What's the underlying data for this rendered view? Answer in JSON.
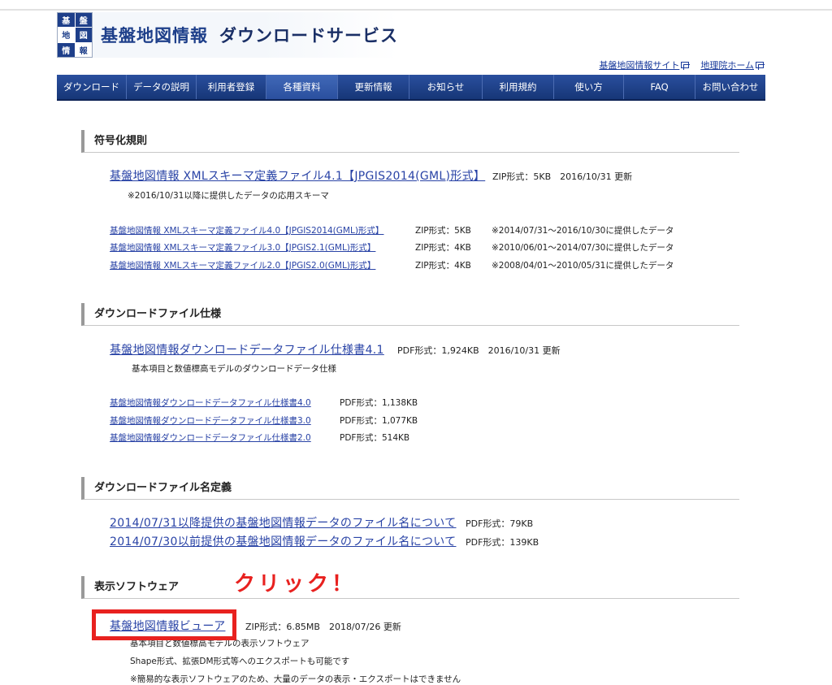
{
  "header": {
    "logo_cells": [
      "基",
      "盤",
      "地",
      "図",
      "情",
      "報"
    ],
    "title": "基盤地図情報",
    "subtitle": "ダウンロードサービス",
    "links": [
      {
        "label": "基盤地図情報サイト"
      },
      {
        "label": "地理院ホーム"
      }
    ]
  },
  "nav": {
    "items": [
      {
        "label": "ダウンロード"
      },
      {
        "label": "データの説明"
      },
      {
        "label": "利用者登録"
      },
      {
        "label": "各種資料",
        "active": true
      },
      {
        "label": "更新情報"
      },
      {
        "label": "お知らせ"
      },
      {
        "label": "利用規約"
      },
      {
        "label": "使い方"
      },
      {
        "label": "FAQ"
      },
      {
        "label": "お問い合わせ"
      }
    ]
  },
  "sections": {
    "encoding": {
      "heading": "符号化規則",
      "main": {
        "link": "基盤地図情報 XMLスキーマ定義ファイル4.1【JPGIS2014(GML)形式】",
        "meta": "ZIP形式：5KB　2016/10/31 更新",
        "note": "※2016/10/31以降に提供したデータの応用スキーマ"
      },
      "rows": [
        {
          "link": "基盤地図情報 XMLスキーマ定義ファイル4.0【JPGIS2014(GML)形式】",
          "format": "ZIP形式：5KB",
          "note": "※2014/07/31～2016/10/30に提供したデータ"
        },
        {
          "link": "基盤地図情報 XMLスキーマ定義ファイル3.0【JPGIS2.1(GML)形式】",
          "format": "ZIP形式：4KB",
          "note": "※2010/06/01～2014/07/30に提供したデータ"
        },
        {
          "link": "基盤地図情報 XMLスキーマ定義ファイル2.0【JPGIS2.0(GML)形式】",
          "format": "ZIP形式：4KB",
          "note": "※2008/04/01～2010/05/31に提供したデータ"
        }
      ]
    },
    "spec": {
      "heading": "ダウンロードファイル仕様",
      "main": {
        "link": "基盤地図情報ダウンロードデータファイル仕様書4.1",
        "meta": "PDF形式：1,924KB　2016/10/31 更新",
        "note": "基本項目と数値標高モデルのダウンロードデータ仕様"
      },
      "rows": [
        {
          "link": "基盤地図情報ダウンロードデータファイル仕様書4.0",
          "format": "PDF形式：1,138KB"
        },
        {
          "link": "基盤地図情報ダウンロードデータファイル仕様書3.0",
          "format": "PDF形式：1,077KB"
        },
        {
          "link": "基盤地図情報ダウンロードデータファイル仕様書2.0",
          "format": "PDF形式：514KB"
        }
      ]
    },
    "naming": {
      "heading": "ダウンロードファイル名定義",
      "rows": [
        {
          "link": "2014/07/31以降提供の基盤地図情報データのファイル名について",
          "format": "PDF形式：79KB"
        },
        {
          "link": "2014/07/30以前提供の基盤地図情報データのファイル名について",
          "format": "PDF形式：139KB"
        }
      ]
    },
    "viewer": {
      "heading": "表示ソフトウェア",
      "main": {
        "link": "基盤地図情報ビューア",
        "meta": "ZIP形式：6.85MB　2018/07/26 更新"
      },
      "notes": [
        "基本項目と数値標高モデルの表示ソフトウェア",
        "Shape形式、拡張DM形式等へのエクスポートも可能です",
        "※簡易的な表示ソフトウェアのため、大量のデータの表示・エクスポートはできません"
      ]
    }
  },
  "annotation": {
    "click_label": "クリック！"
  },
  "colors": {
    "nav": "#1e3f8a",
    "link": "#2943a6",
    "highlight": "#e8211f"
  }
}
